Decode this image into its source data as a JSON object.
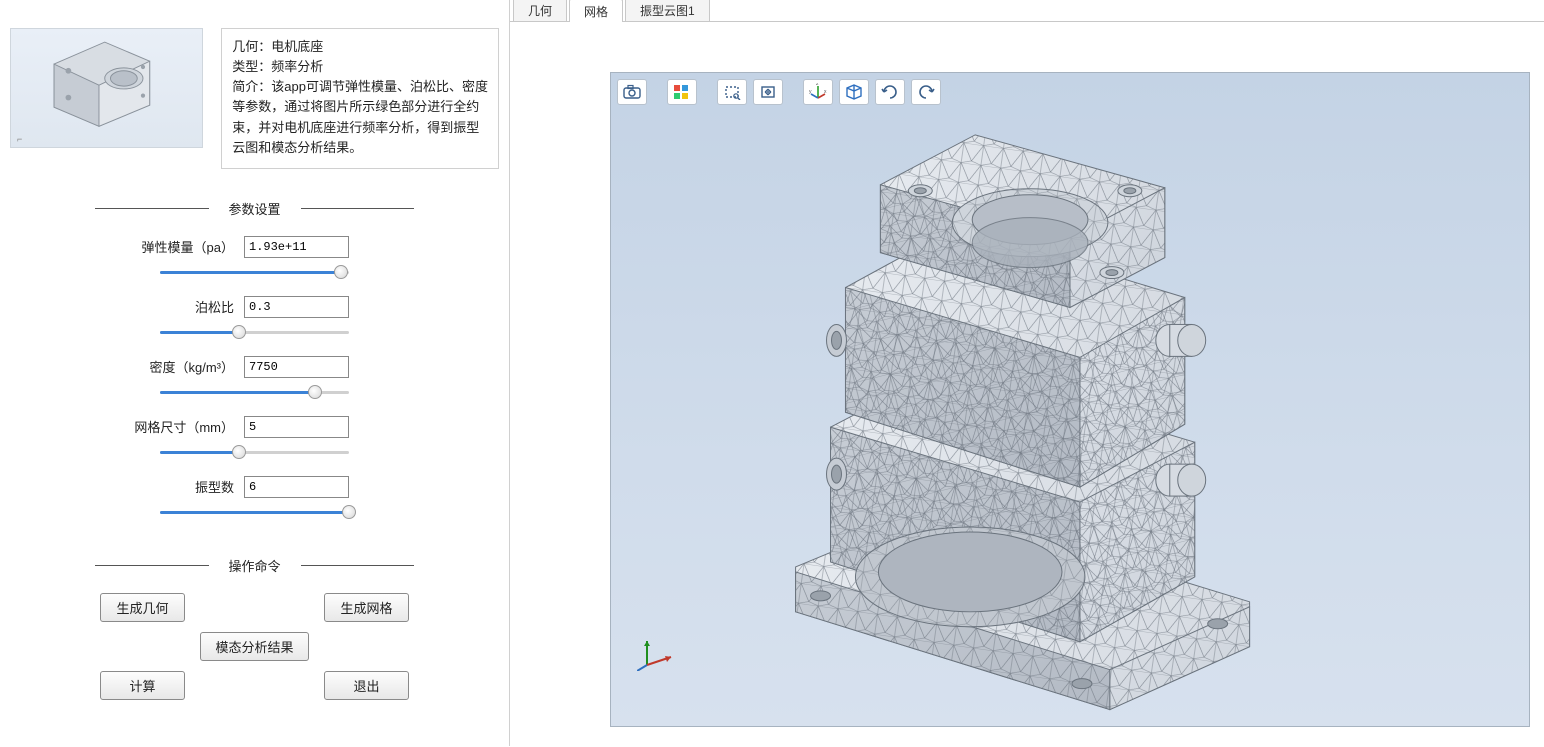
{
  "info": {
    "geom_label": "几何：",
    "geom_value": "电机底座",
    "type_label": "类型：",
    "type_value": "频率分析",
    "desc_label": "简介：",
    "desc_value": "该app可调节弹性模量、泊松比、密度等参数，通过将图片所示绿色部分进行全约束，并对电机底座进行频率分析，得到振型云图和模态分析结果。"
  },
  "sections": {
    "params_title": "参数设置",
    "ops_title": "操作命令"
  },
  "params": {
    "elastic": {
      "label": "弹性模量（pa）",
      "value": "1.93e+11",
      "pct": 96
    },
    "poisson": {
      "label": "泊松比",
      "value": "0.3",
      "pct": 42
    },
    "density": {
      "label": "密度（kg/m³）",
      "value": "7750",
      "pct": 82
    },
    "mesh": {
      "label": "网格尺寸（mm）",
      "value": "5",
      "pct": 42
    },
    "modes": {
      "label": "振型数",
      "value": "6",
      "pct": 100
    }
  },
  "buttons": {
    "gen_geom": "生成几何",
    "gen_mesh": "生成网格",
    "modal_result": "模态分析结果",
    "compute": "计算",
    "exit": "退出"
  },
  "tabs": {
    "geom": "几何",
    "mesh": "网格",
    "cloud": "振型云图1"
  },
  "toolbar_icons": {
    "camera": "camera-icon",
    "palette": "palette-icon",
    "select_box": "select-box-icon",
    "move": "move-icon",
    "axes": "axes-icon",
    "cube": "cube-icon",
    "rotate_ccw": "rotate-ccw-icon",
    "rotate_cw": "rotate-cw-icon"
  }
}
